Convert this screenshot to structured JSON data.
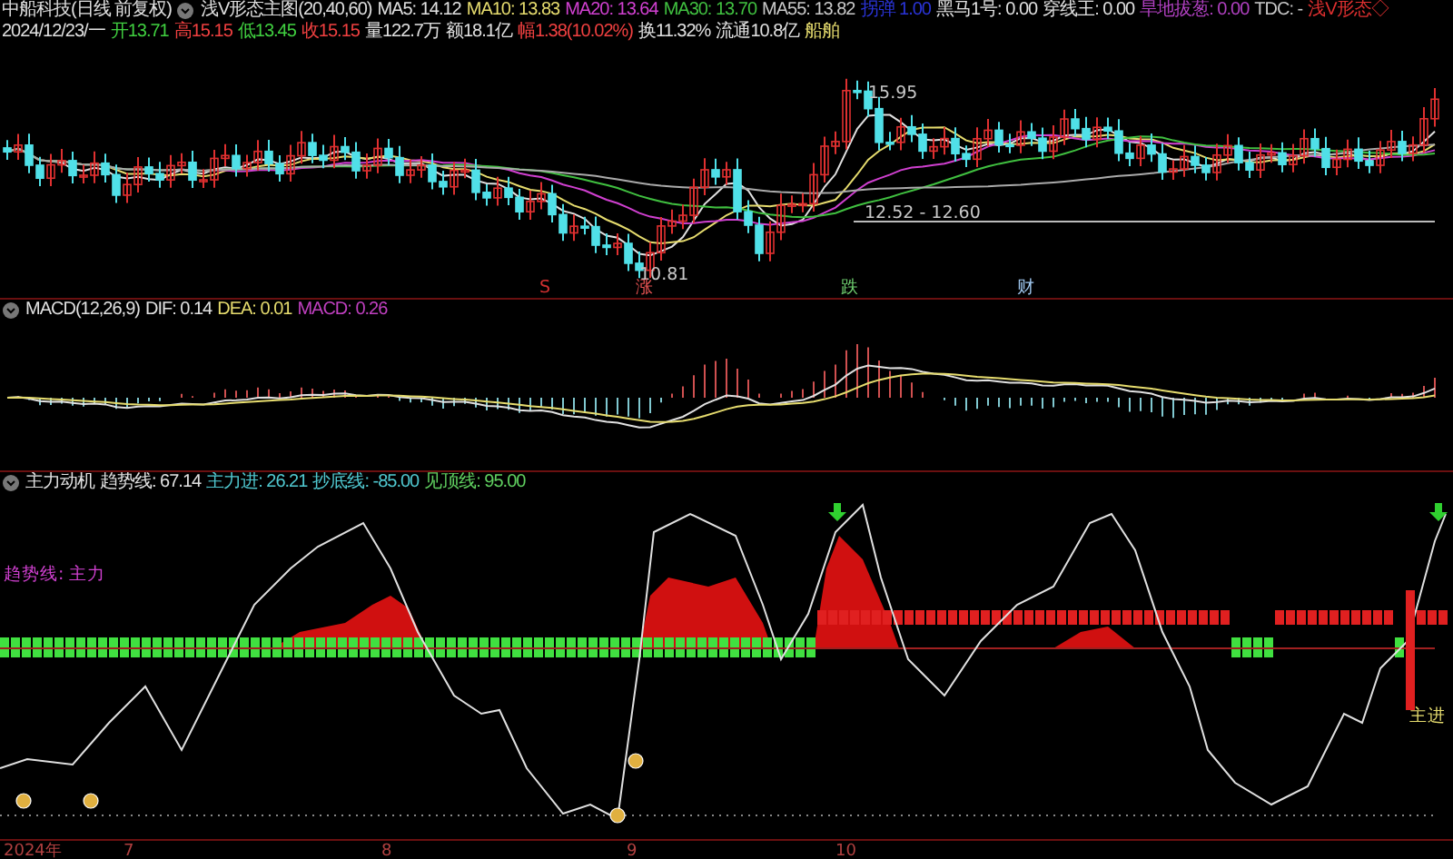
{
  "header": {
    "stock": "中船科技(日线 前复权)",
    "indicator_name": "浅V形态主图(20,40,60)",
    "indicators": [
      {
        "text": "MA5: 14.12",
        "color": "#e0e0e0"
      },
      {
        "text": "MA10: 13.83",
        "color": "#e6dc6e"
      },
      {
        "text": "MA20: 13.64",
        "color": "#d040d0"
      },
      {
        "text": "MA30: 13.70",
        "color": "#40c040"
      },
      {
        "text": "MA55: 13.82",
        "color": "#c8c8c8"
      },
      {
        "text": "拐弹 1.00",
        "color": "#2a34d8"
      },
      {
        "text": "黑马1号: 0.00",
        "color": "#e0e0e0"
      },
      {
        "text": "穿线王: 0.00",
        "color": "#e0e0e0"
      },
      {
        "text": "旱地拔葱: 0.00",
        "color": "#b040c0"
      },
      {
        "text": "TDC: -",
        "color": "#c8c8c8"
      },
      {
        "text": "浅V形态◇",
        "color": "#e03030"
      }
    ],
    "quote": [
      {
        "text": "2024/12/23/一",
        "color": "#e0e0e0"
      },
      {
        "text": "开13.71",
        "color": "#40d040"
      },
      {
        "text": "高15.15",
        "color": "#f04040"
      },
      {
        "text": "低13.45",
        "color": "#40d040"
      },
      {
        "text": "收15.15",
        "color": "#f04040"
      },
      {
        "text": "量122.7万",
        "color": "#e0e0e0"
      },
      {
        "text": "额18.1亿",
        "color": "#e0e0e0"
      },
      {
        "text": "幅1.38(10.02%)",
        "color": "#f04040"
      },
      {
        "text": "换11.32%",
        "color": "#e0e0e0"
      },
      {
        "text": "流通10.8亿",
        "color": "#e0e0e0"
      },
      {
        "text": "船舶",
        "color": "#e6dc6e"
      }
    ]
  },
  "main_chart": {
    "annotations": [
      {
        "text": "15.95",
        "kind": "price"
      },
      {
        "text": "12.52 - 12.60",
        "kind": "price"
      },
      {
        "text": "10.81",
        "kind": "price"
      },
      {
        "text": "S",
        "kind": "signal",
        "color": "#d03030"
      },
      {
        "text": "涨",
        "kind": "signal",
        "color": "#e05050"
      },
      {
        "text": "跌",
        "kind": "signal",
        "color": "#70d070"
      },
      {
        "text": "财",
        "kind": "signal",
        "color": "#a0c8f0"
      }
    ]
  },
  "macd": {
    "title": "MACD(12,26,9)",
    "items": [
      {
        "text": "DIF: 0.14",
        "color": "#e0e0e0"
      },
      {
        "text": "DEA: 0.01",
        "color": "#e6dc6e"
      },
      {
        "text": "MACD: 0.26",
        "color": "#c040c0"
      }
    ]
  },
  "force": {
    "title": "主力动机",
    "items": [
      {
        "text": "趋势线: 67.14",
        "color": "#e0e0e0"
      },
      {
        "text": "主力进: 26.21",
        "color": "#50c8d0"
      },
      {
        "text": "抄底线: -85.00",
        "color": "#50c8d0"
      },
      {
        "text": "见顶线: 95.00",
        "color": "#60d060"
      }
    ],
    "legend": "趋势线: 主力",
    "marker": "主进"
  },
  "x_axis": [
    "2024年",
    "7",
    "8",
    "9",
    "10"
  ]
}
